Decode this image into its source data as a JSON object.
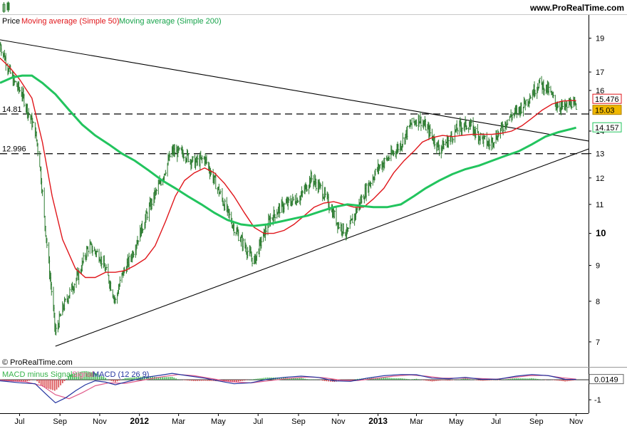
{
  "header": {
    "brand": "www.ProRealTime.com",
    "legend_price": "Price",
    "legend_ma50": "Moving average (Simple 50)",
    "legend_ma200": "Moving average (Simple 200)",
    "copyright": "© ProRealTime.com"
  },
  "macd": {
    "legend_hist": "MACD minus Signal",
    "legend_signal": "Signal",
    "legend_macd": "MACD (12 26 9)",
    "current": "0.0149",
    "tick_zero": "0",
    "tick_minus1": "-1"
  },
  "colors": {
    "price_bar": "#2e7d32",
    "ma50": "#e0161b",
    "ma200": "#22c45e",
    "trendline": "#000000",
    "hist_up": "#36b34a",
    "hist_down": "#d9464a",
    "signal": "#e05a8a",
    "macd": "#2435a0",
    "current_badge": "#f0b800"
  },
  "chart_data": {
    "type": "line",
    "instrument_legend": [
      "Price",
      "Moving average (Simple 50)",
      "Moving average (Simple 200)"
    ],
    "y_scale": "log",
    "y_ticks": [
      7,
      8,
      9,
      10,
      11,
      12,
      13,
      14,
      15,
      16,
      17,
      19
    ],
    "y_tick_labels": [
      "7",
      "8",
      "9",
      "10",
      "11",
      "12",
      "13",
      "14",
      "15",
      "16",
      "17",
      "19"
    ],
    "x_tick_labels": [
      "Jul",
      "Sep",
      "Nov",
      "2012",
      "Mar",
      "May",
      "Jul",
      "Sep",
      "Nov",
      "2013",
      "Mar",
      "May",
      "Jul",
      "Sep",
      "Nov"
    ],
    "x_tick_dates": [
      "2011-07-01",
      "2011-09-01",
      "2011-11-01",
      "2012-01-01",
      "2012-03-01",
      "2012-05-01",
      "2012-07-01",
      "2012-09-01",
      "2012-11-01",
      "2013-01-01",
      "2013-03-01",
      "2013-05-01",
      "2013-07-01",
      "2013-09-01",
      "2013-11-01"
    ],
    "x_range": [
      "2011-06-01",
      "2013-11-20"
    ],
    "y_range": [
      6.6,
      19.8
    ],
    "last_values": {
      "ma50": "15.476",
      "price": "15.03",
      "ma200": "14.157"
    },
    "horizontal_levels": [
      {
        "label": "14.81",
        "value": 14.81,
        "style": "dashed"
      },
      {
        "label": "12.996",
        "value": 12.996,
        "style": "dashed"
      }
    ],
    "trendlines": [
      {
        "name": "resistance",
        "from": [
          "2011-06-01",
          18.9
        ],
        "to": [
          "2013-11-20",
          13.55
        ]
      },
      {
        "name": "support",
        "from": [
          "2011-08-25",
          6.9
        ],
        "to": [
          "2013-11-20",
          13.2
        ]
      }
    ],
    "price_points": [
      [
        "2011-06-01",
        18.6
      ],
      [
        "2011-06-20",
        16.6
      ],
      [
        "2011-07-05",
        15.8
      ],
      [
        "2011-07-15",
        14.8
      ],
      [
        "2011-07-25",
        14.0
      ],
      [
        "2011-08-01",
        12.6
      ],
      [
        "2011-08-08",
        10.5
      ],
      [
        "2011-08-15",
        9.0
      ],
      [
        "2011-08-25",
        7.2
      ],
      [
        "2011-09-05",
        7.8
      ],
      [
        "2011-09-15",
        8.2
      ],
      [
        "2011-10-01",
        8.8
      ],
      [
        "2011-10-15",
        9.6
      ],
      [
        "2011-11-01",
        9.3
      ],
      [
        "2011-11-15",
        8.6
      ],
      [
        "2011-11-25",
        8.0
      ],
      [
        "2011-12-05",
        8.7
      ],
      [
        "2011-12-20",
        9.3
      ],
      [
        "2012-01-05",
        10.2
      ],
      [
        "2012-01-20",
        11.1
      ],
      [
        "2012-02-05",
        12.0
      ],
      [
        "2012-02-20",
        13.1
      ],
      [
        "2012-03-10",
        13.0
      ],
      [
        "2012-03-25",
        12.6
      ],
      [
        "2012-04-10",
        12.8
      ],
      [
        "2012-04-25",
        11.9
      ],
      [
        "2012-05-10",
        11.0
      ],
      [
        "2012-05-25",
        10.2
      ],
      [
        "2012-06-10",
        9.6
      ],
      [
        "2012-06-25",
        9.1
      ],
      [
        "2012-07-05",
        9.7
      ],
      [
        "2012-07-20",
        10.5
      ],
      [
        "2012-08-05",
        10.9
      ],
      [
        "2012-08-20",
        11.1
      ],
      [
        "2012-09-05",
        11.3
      ],
      [
        "2012-09-20",
        12.0
      ],
      [
        "2012-10-05",
        11.6
      ],
      [
        "2012-10-20",
        10.9
      ],
      [
        "2012-11-01",
        10.3
      ],
      [
        "2012-11-15",
        10.0
      ],
      [
        "2012-12-01",
        10.9
      ],
      [
        "2012-12-15",
        11.6
      ],
      [
        "2013-01-01",
        12.4
      ],
      [
        "2013-01-20",
        12.9
      ],
      [
        "2013-02-05",
        13.4
      ],
      [
        "2013-02-20",
        14.3
      ],
      [
        "2013-03-05",
        14.6
      ],
      [
        "2013-03-20",
        14.0
      ],
      [
        "2013-04-05",
        13.2
      ],
      [
        "2013-04-20",
        13.6
      ],
      [
        "2013-05-05",
        14.2
      ],
      [
        "2013-05-20",
        14.3
      ],
      [
        "2013-06-05",
        13.8
      ],
      [
        "2013-06-20",
        13.4
      ],
      [
        "2013-07-05",
        13.9
      ],
      [
        "2013-07-20",
        14.6
      ],
      [
        "2013-08-05",
        15.0
      ],
      [
        "2013-08-20",
        15.6
      ],
      [
        "2013-09-05",
        16.4
      ],
      [
        "2013-09-20",
        16.0
      ],
      [
        "2013-10-01",
        15.3
      ],
      [
        "2013-10-15",
        15.1
      ],
      [
        "2013-10-25",
        15.4
      ],
      [
        "2013-11-01",
        15.03
      ]
    ],
    "series": [
      {
        "name": "Moving average (Simple 50)",
        "color": "#e0161b",
        "points": [
          [
            "2011-06-01",
            17.8
          ],
          [
            "2011-06-15",
            17.3
          ],
          [
            "2011-07-01",
            16.6
          ],
          [
            "2011-07-20",
            15.6
          ],
          [
            "2011-08-05",
            13.5
          ],
          [
            "2011-08-20",
            11.3
          ],
          [
            "2011-09-05",
            9.8
          ],
          [
            "2011-09-25",
            8.9
          ],
          [
            "2011-10-10",
            8.65
          ],
          [
            "2011-10-25",
            8.65
          ],
          [
            "2011-11-10",
            8.8
          ],
          [
            "2011-11-25",
            8.8
          ],
          [
            "2011-12-10",
            8.85
          ],
          [
            "2011-12-25",
            9.0
          ],
          [
            "2012-01-10",
            9.2
          ],
          [
            "2012-01-25",
            9.6
          ],
          [
            "2012-02-10",
            10.4
          ],
          [
            "2012-02-25",
            11.3
          ],
          [
            "2012-03-10",
            11.9
          ],
          [
            "2012-03-25",
            12.2
          ],
          [
            "2012-04-10",
            12.4
          ],
          [
            "2012-04-25",
            12.2
          ],
          [
            "2012-05-10",
            11.8
          ],
          [
            "2012-05-25",
            11.3
          ],
          [
            "2012-06-10",
            10.7
          ],
          [
            "2012-06-25",
            10.2
          ],
          [
            "2012-07-10",
            10.0
          ],
          [
            "2012-07-25",
            10.0
          ],
          [
            "2012-08-10",
            10.1
          ],
          [
            "2012-08-25",
            10.3
          ],
          [
            "2012-09-10",
            10.6
          ],
          [
            "2012-09-25",
            10.9
          ],
          [
            "2012-10-10",
            11.05
          ],
          [
            "2012-10-25",
            11.1
          ],
          [
            "2012-11-10",
            11.0
          ],
          [
            "2012-11-25",
            10.9
          ],
          [
            "2012-12-10",
            10.9
          ],
          [
            "2012-12-25",
            11.2
          ],
          [
            "2013-01-10",
            11.6
          ],
          [
            "2013-01-25",
            12.2
          ],
          [
            "2013-02-10",
            12.7
          ],
          [
            "2013-02-25",
            13.1
          ],
          [
            "2013-03-10",
            13.5
          ],
          [
            "2013-03-25",
            13.7
          ],
          [
            "2013-04-10",
            13.8
          ],
          [
            "2013-04-25",
            13.75
          ],
          [
            "2013-05-10",
            13.8
          ],
          [
            "2013-05-25",
            13.85
          ],
          [
            "2013-06-10",
            13.85
          ],
          [
            "2013-06-25",
            13.85
          ],
          [
            "2013-07-10",
            13.9
          ],
          [
            "2013-07-25",
            14.0
          ],
          [
            "2013-08-10",
            14.25
          ],
          [
            "2013-08-25",
            14.6
          ],
          [
            "2013-09-10",
            15.0
          ],
          [
            "2013-09-25",
            15.3
          ],
          [
            "2013-10-10",
            15.45
          ],
          [
            "2013-10-25",
            15.48
          ],
          [
            "2013-11-01",
            15.476
          ]
        ]
      },
      {
        "name": "Moving average (Simple 200)",
        "color": "#22c45e",
        "points": [
          [
            "2011-06-01",
            16.4
          ],
          [
            "2011-06-20",
            16.7
          ],
          [
            "2011-07-05",
            16.8
          ],
          [
            "2011-07-20",
            16.8
          ],
          [
            "2011-08-05",
            16.4
          ],
          [
            "2011-08-25",
            15.8
          ],
          [
            "2011-09-15",
            15.0
          ],
          [
            "2011-10-05",
            14.3
          ],
          [
            "2011-10-25",
            13.8
          ],
          [
            "2011-11-15",
            13.4
          ],
          [
            "2011-12-05",
            13.0
          ],
          [
            "2011-12-25",
            12.7
          ],
          [
            "2012-01-15",
            12.3
          ],
          [
            "2012-02-05",
            11.9
          ],
          [
            "2012-02-25",
            11.6
          ],
          [
            "2012-03-15",
            11.3
          ],
          [
            "2012-04-05",
            11.0
          ],
          [
            "2012-04-25",
            10.7
          ],
          [
            "2012-05-15",
            10.45
          ],
          [
            "2012-06-05",
            10.3
          ],
          [
            "2012-06-25",
            10.25
          ],
          [
            "2012-07-15",
            10.3
          ],
          [
            "2012-08-05",
            10.4
          ],
          [
            "2012-08-25",
            10.5
          ],
          [
            "2012-09-15",
            10.6
          ],
          [
            "2012-10-05",
            10.75
          ],
          [
            "2012-10-25",
            10.9
          ],
          [
            "2012-11-15",
            11.0
          ],
          [
            "2012-12-05",
            10.95
          ],
          [
            "2012-12-25",
            10.9
          ],
          [
            "2013-01-15",
            10.9
          ],
          [
            "2013-02-05",
            11.0
          ],
          [
            "2013-02-25",
            11.3
          ],
          [
            "2013-03-15",
            11.6
          ],
          [
            "2013-04-05",
            11.9
          ],
          [
            "2013-04-25",
            12.15
          ],
          [
            "2013-05-15",
            12.35
          ],
          [
            "2013-06-05",
            12.5
          ],
          [
            "2013-06-25",
            12.7
          ],
          [
            "2013-07-15",
            12.9
          ],
          [
            "2013-08-05",
            13.1
          ],
          [
            "2013-08-25",
            13.4
          ],
          [
            "2013-09-15",
            13.75
          ],
          [
            "2013-10-05",
            13.95
          ],
          [
            "2013-10-25",
            14.1
          ],
          [
            "2013-11-01",
            14.157
          ]
        ]
      }
    ],
    "macd_indicator": {
      "name": "MACD (12 26 9)",
      "y_ticks": [
        0,
        -1
      ],
      "y_range": [
        -1.6,
        0.5
      ],
      "current": 0.0149,
      "macd_points": [
        [
          "2011-06-01",
          -0.05
        ],
        [
          "2011-07-01",
          -0.15
        ],
        [
          "2011-07-25",
          -0.2
        ],
        [
          "2011-08-10",
          -0.7
        ],
        [
          "2011-08-25",
          -1.15
        ],
        [
          "2011-09-10",
          -0.9
        ],
        [
          "2011-09-25",
          -0.55
        ],
        [
          "2011-10-10",
          -0.25
        ],
        [
          "2011-10-25",
          -0.05
        ],
        [
          "2011-11-10",
          -0.12
        ],
        [
          "2011-11-25",
          -0.25
        ],
        [
          "2011-12-15",
          -0.08
        ],
        [
          "2012-01-10",
          0.12
        ],
        [
          "2012-02-01",
          0.22
        ],
        [
          "2012-02-20",
          0.32
        ],
        [
          "2012-03-15",
          0.2
        ],
        [
          "2012-04-10",
          0.08
        ],
        [
          "2012-05-05",
          -0.08
        ],
        [
          "2012-05-25",
          -0.2
        ],
        [
          "2012-06-20",
          -0.15
        ],
        [
          "2012-07-15",
          0.02
        ],
        [
          "2012-08-10",
          0.12
        ],
        [
          "2012-09-05",
          0.18
        ],
        [
          "2012-10-01",
          0.12
        ],
        [
          "2012-10-25",
          -0.05
        ],
        [
          "2012-11-20",
          -0.08
        ],
        [
          "2012-12-15",
          0.08
        ],
        [
          "2013-01-10",
          0.2
        ],
        [
          "2013-02-05",
          0.26
        ],
        [
          "2013-03-01",
          0.25
        ],
        [
          "2013-03-25",
          0.08
        ],
        [
          "2013-04-20",
          0.05
        ],
        [
          "2013-05-15",
          0.12
        ],
        [
          "2013-06-10",
          0.02
        ],
        [
          "2013-07-05",
          0.03
        ],
        [
          "2013-08-01",
          0.18
        ],
        [
          "2013-08-25",
          0.26
        ],
        [
          "2013-09-20",
          0.2
        ],
        [
          "2013-10-15",
          0.02
        ],
        [
          "2013-11-01",
          0.0149
        ]
      ],
      "signal_points": [
        [
          "2011-06-01",
          -0.02
        ],
        [
          "2011-07-10",
          -0.1
        ],
        [
          "2011-08-05",
          -0.3
        ],
        [
          "2011-08-25",
          -0.75
        ],
        [
          "2011-09-15",
          -0.95
        ],
        [
          "2011-10-05",
          -0.65
        ],
        [
          "2011-10-25",
          -0.3
        ],
        [
          "2011-11-15",
          -0.15
        ],
        [
          "2011-12-10",
          -0.18
        ],
        [
          "2012-01-10",
          0.0
        ],
        [
          "2012-02-05",
          0.15
        ],
        [
          "2012-03-01",
          0.26
        ],
        [
          "2012-03-25",
          0.2
        ],
        [
          "2012-04-20",
          0.06
        ],
        [
          "2012-05-20",
          -0.1
        ],
        [
          "2012-06-20",
          -0.16
        ],
        [
          "2012-07-20",
          -0.04
        ],
        [
          "2012-08-20",
          0.08
        ],
        [
          "2012-09-15",
          0.14
        ],
        [
          "2012-10-10",
          0.1
        ],
        [
          "2012-11-05",
          -0.02
        ],
        [
          "2012-12-01",
          -0.04
        ],
        [
          "2012-12-25",
          0.06
        ],
        [
          "2013-01-25",
          0.18
        ],
        [
          "2013-02-20",
          0.24
        ],
        [
          "2013-03-15",
          0.18
        ],
        [
          "2013-04-10",
          0.08
        ],
        [
          "2013-05-05",
          0.08
        ],
        [
          "2013-06-01",
          0.07
        ],
        [
          "2013-07-01",
          0.03
        ],
        [
          "2013-07-25",
          0.1
        ],
        [
          "2013-08-20",
          0.2
        ],
        [
          "2013-09-15",
          0.22
        ],
        [
          "2013-10-10",
          0.1
        ],
        [
          "2013-11-01",
          0.03
        ]
      ]
    }
  }
}
